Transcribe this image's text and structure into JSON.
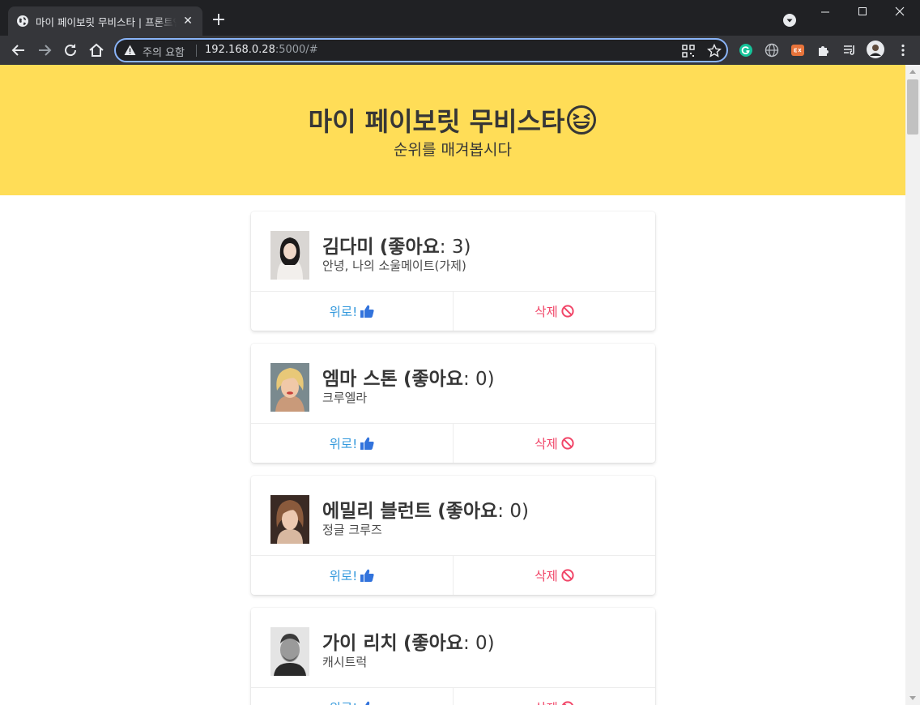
{
  "browser": {
    "tab_title": "마이 페이보릿 무비스타 | 프론트엔드",
    "security_label": "주의 요함",
    "url_host": "192.168.0.28",
    "url_rest": ":5000/#"
  },
  "hero": {
    "title": "마이 페이보릿 무비스타",
    "subtitle": "순위를 매겨봅시다"
  },
  "cards": [
    {
      "name": "김다미",
      "likes_prefix": "(좋아요",
      "likes_suffix": ": 3)",
      "movie": "안녕, 나의 소울메이트(가제)",
      "like_label": "위로!",
      "delete_label": "삭제"
    },
    {
      "name": "엠마 스톤",
      "likes_prefix": "(좋아요",
      "likes_suffix": ": 0)",
      "movie": "크루엘라",
      "like_label": "위로!",
      "delete_label": "삭제"
    },
    {
      "name": "에밀리 블런트",
      "likes_prefix": "(좋아요",
      "likes_suffix": ": 0)",
      "movie": "정글 크루즈",
      "like_label": "위로!",
      "delete_label": "삭제"
    },
    {
      "name": "가이 리치",
      "likes_prefix": "(좋아요",
      "likes_suffix": ": 0)",
      "movie": "캐시트럭",
      "like_label": "위로!",
      "delete_label": "삭제"
    }
  ],
  "colors": {
    "hero_bg": "#ffdd57",
    "like": "#3298dc",
    "delete": "#f14668"
  },
  "icons": {
    "like": "thumbs-up-icon",
    "delete": "ban-icon",
    "hero": "laughing-face-icon"
  }
}
